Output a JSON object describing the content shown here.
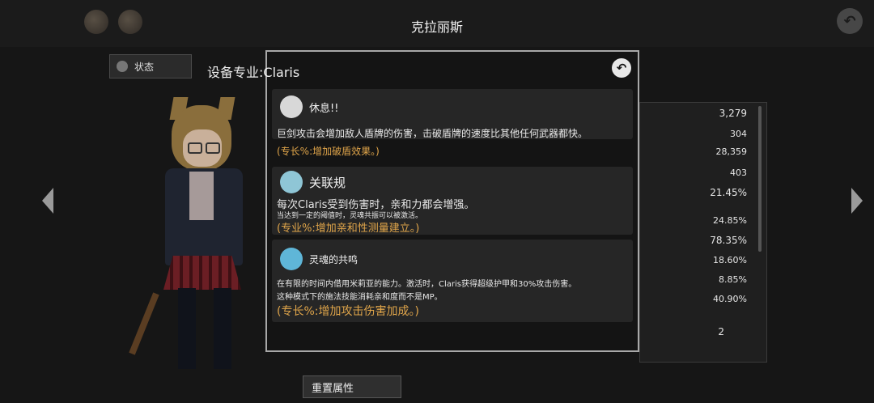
{
  "header": {
    "title": "克拉丽斯"
  },
  "sidebar": {
    "status_tab": "状态"
  },
  "stats": [
    "3,279",
    "304",
    "28,359",
    "403",
    "21.45%",
    "24.85%",
    "78.35%",
    "18.60%",
    "8.85%",
    "40.90%",
    "2"
  ],
  "footer": {
    "reset_label": "重置属性"
  },
  "modal": {
    "title": "设备专业:Claris",
    "skills": [
      {
        "name": "休息!!",
        "lines": [
          "巨剑攻击会增加敌人盾牌的伤害，击破盾牌的速度比其他任何武器都快。"
        ],
        "hint": "(专长%:增加破盾效果。)"
      },
      {
        "name": "关联规",
        "lines": [
          "每次Claris受到伤害时，亲和力都会增强。",
          "当达到一定的阈值时，灵魂共振可以被激活。"
        ],
        "hint": "(专业%:增加亲和性测量建立。)"
      },
      {
        "name": "灵魂的共鸣",
        "lines": [
          "在有限的时间内借用米莉亚的能力。激活时，Claris获得超级护甲和30%攻击伤害。",
          "这种模式下的施法技能消耗亲和度而不是MP。"
        ],
        "hint": "(专长%:增加攻击伤害加成。)"
      }
    ]
  }
}
